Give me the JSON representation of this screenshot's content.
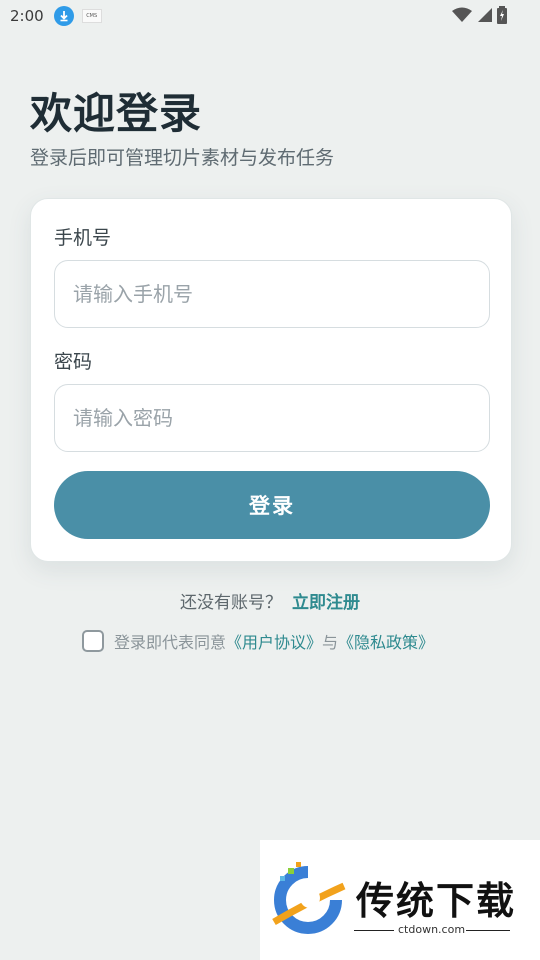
{
  "status_bar": {
    "time": "2:00",
    "app_icon_text": "CMS"
  },
  "header": {
    "title": "欢迎登录",
    "subtitle": "登录后即可管理切片素材与发布任务"
  },
  "form": {
    "phone_label": "手机号",
    "phone_placeholder": "请输入手机号",
    "phone_value": "",
    "password_label": "密码",
    "password_placeholder": "请输入密码",
    "password_value": "",
    "login_button": "登录"
  },
  "register": {
    "prompt": "还没有账号？",
    "link": "立即注册"
  },
  "agreement": {
    "prefix": "登录即代表同意",
    "user_agreement": "《用户协议》",
    "conjunction": "与",
    "privacy_policy": "《隐私政策》",
    "checked": false
  },
  "watermark": {
    "title": "传统下载",
    "domain": "ctdown.com"
  },
  "colors": {
    "background": "#edf0ef",
    "primary": "#4a8fa7",
    "link": "#2e8a8f",
    "title": "#1f2d35"
  }
}
